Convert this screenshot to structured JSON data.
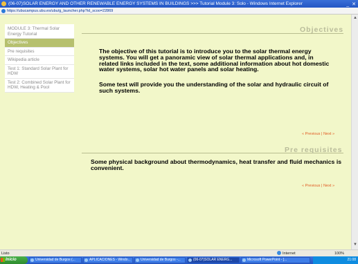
{
  "window": {
    "title": "(06-07)SOLAR ENERGY AND OTHER RENEWABLE ENERGY SYSTEMS IN BUILDINGS >>> Tutorial Module 3: Solo - Windows Internet Explorer",
    "controls": "_ ✕",
    "url": "https://ubucampus.ubu.es/ubu/g_launcher.php?id_scoo=22869"
  },
  "sidebar": {
    "items": [
      {
        "label": "MODULE 3: Thermal Solar Energy Tutorial"
      },
      {
        "label": "Objectives"
      },
      {
        "label": "Pre requisites"
      },
      {
        "label": "Wikipedia article"
      },
      {
        "label": "Test 1: Standard Solar Plant for HDW"
      },
      {
        "label": "Test 2: Combined Solar Plant for HDW, Heating & Pool"
      }
    ]
  },
  "objectives": {
    "title": "Objectives",
    "para1": "The objective of this tutorial is to introduce you to the solar thermal energy systems. You will get a panoramic view of solar thermal applications and, in related links included in the text, some additional information about hot domestic water systems, solar hot water panels and solar heating.",
    "para2": "Some test will provide you the understanding of the solar and hydraulic circuit of such systems.",
    "nav": "« Previous | Next »"
  },
  "prerequisites": {
    "title": "Pre requisites",
    "para": "Some physical background about thermodynamics, heat transfer and fluid mechanics is convenient.",
    "nav": "« Previous | Next »"
  },
  "statusbar": {
    "text": "Listo",
    "zone": "Internet",
    "zoom": "100%"
  },
  "taskbar": {
    "start": "Inicio",
    "tasks": [
      {
        "label": "Universidad de Burgos (..."
      },
      {
        "label": "APLICACIONES - Windo..."
      },
      {
        "label": "Universidad de Burgos -..."
      },
      {
        "label": "(06-07)SOLAR ENERG..."
      },
      {
        "label": "Microsoft PowerPoint - [..."
      }
    ],
    "clock": "21:08"
  }
}
